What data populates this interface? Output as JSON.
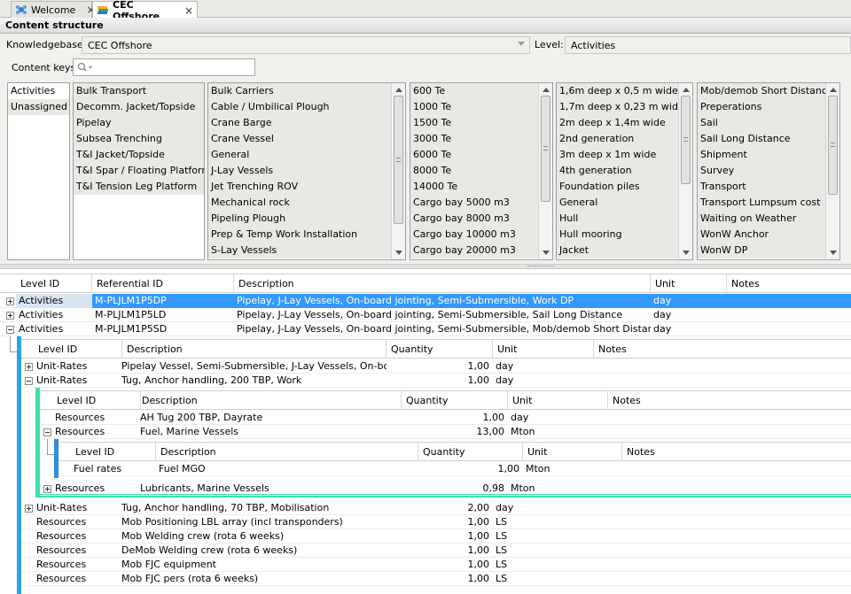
{
  "tabs": [
    {
      "label": "Welcome",
      "close": "×"
    },
    {
      "label": "CEC Offshore",
      "close": "×"
    }
  ],
  "section_title": "Content structure",
  "knowledgebase": {
    "label": "Knowledgebase:",
    "value": "CEC Offshore"
  },
  "level": {
    "label": "Level:",
    "value": "Activities"
  },
  "content_keys": {
    "label": "Content keys",
    "placeholder": ""
  },
  "lists": {
    "col1": [
      "Activities",
      "Unassigned"
    ],
    "col2": [
      "Bulk Transport",
      "Decomm. Jacket/Topside",
      "Pipelay",
      "Subsea Trenching",
      "T&I Jacket/Topside",
      "T&I Spar / Floating Platform",
      "T&I Tension Leg Platform"
    ],
    "col3": [
      "Bulk Carriers",
      "Cable / Umbilical Plough",
      "Crane Barge",
      "Crane Vessel",
      "General",
      "J-Lay Vessels",
      "Jet Trenching ROV",
      "Mechanical rock",
      "Pipeling Plough",
      "Prep & Temp Work Installation",
      "S-Lay Vessels"
    ],
    "col4": [
      "600 Te",
      "1000 Te",
      "1500 Te",
      "3000 Te",
      "6000 Te",
      "8000 Te",
      "14000 Te",
      "Cargo bay 5000 m3",
      "Cargo bay 8000 m3",
      "Cargo bay 10000 m3",
      "Cargo bay 20000 m3"
    ],
    "col5": [
      "1,6m deep x 0,5 m wide",
      "1,7m deep x 0,23 m wide",
      "2m deep x 1,4m wide",
      "2nd generation",
      "3m deep x 1m wide",
      "4th generation",
      "Foundation piles",
      "General",
      "Hull",
      "Hull mooring",
      "Jacket"
    ],
    "col6": [
      "Mob/demob Short Distance",
      "Preperations",
      "Sail",
      "Sail Long Distance",
      "Shipment",
      "Survey",
      "Transport",
      "Transport Lumpsum cost",
      "Waiting on Weather",
      "WonW Anchor",
      "WonW DP"
    ]
  },
  "main_grid": {
    "headers": [
      "Level ID",
      "Referential ID",
      "Description",
      "Unit",
      "Notes"
    ],
    "rows": [
      {
        "level": "Activities",
        "ref": "M-PLJLM1P5DP",
        "desc": "Pipelay, J-Lay Vessels, On-board jointing, Semi-Submersible, Work DP",
        "unit": "day"
      },
      {
        "level": "Activities",
        "ref": "M-PLJLM1P5LD",
        "desc": "Pipelay, J-Lay Vessels, On-board jointing, Semi-Submersible, Sail Long Distance",
        "unit": "day"
      },
      {
        "level": "Activities",
        "ref": "M-PLJLM1P5SD",
        "desc": "Pipelay, J-Lay Vessels, On-board jointing, Semi-Submersible, Mob/demob Short Distance",
        "unit": "day"
      }
    ]
  },
  "sub1": {
    "headers": [
      "Level ID",
      "Description",
      "Quantity",
      "Unit",
      "Notes"
    ],
    "rows": [
      {
        "level": "Unit-Rates",
        "desc": "Pipelay Vessel, Semi-Submersible, J-Lay Vessels, On-board ...",
        "qty": "1,00",
        "unit": "day"
      },
      {
        "level": "Unit-Rates",
        "desc": "Tug, Anchor handling, 200 TBP, Work",
        "qty": "1,00",
        "unit": "day"
      }
    ],
    "rows_after": [
      {
        "level": "Unit-Rates",
        "desc": "Tug, Anchor handling, 70 TBP, Mobilisation",
        "qty": "2,00",
        "unit": "day"
      },
      {
        "level": "Resources",
        "desc": "Mob Positioning LBL array (incl transponders)",
        "qty": "1,00",
        "unit": "LS"
      },
      {
        "level": "Resources",
        "desc": "Mob Welding crew (rota 6 weeks)",
        "qty": "1,00",
        "unit": "LS"
      },
      {
        "level": "Resources",
        "desc": "DeMob Welding crew (rota 6 weeks)",
        "qty": "1,00",
        "unit": "LS"
      },
      {
        "level": "Resources",
        "desc": "Mob FJC equipment",
        "qty": "1,00",
        "unit": "LS"
      },
      {
        "level": "Resources",
        "desc": "Mob FJC pers (rota 6 weeks)",
        "qty": "1,00",
        "unit": "LS"
      }
    ]
  },
  "sub2": {
    "headers": [
      "Level ID",
      "Description",
      "Quantity",
      "Unit",
      "Notes"
    ],
    "rows": [
      {
        "level": "Resources",
        "desc": "AH Tug 200 TBP, Dayrate",
        "qty": "1,00",
        "unit": "day"
      },
      {
        "level": "Resources",
        "desc": "Fuel, Marine Vessels",
        "qty": "13,00",
        "unit": "Mton"
      }
    ],
    "rows_after": [
      {
        "level": "Resources",
        "desc": "Lubricants, Marine Vessels",
        "qty": "0,98",
        "unit": "Mton"
      }
    ]
  },
  "sub3": {
    "headers": [
      "Level ID",
      "Description",
      "Quantity",
      "Unit",
      "Notes"
    ],
    "rows": [
      {
        "level": "Fuel rates",
        "desc": "Fuel MGO",
        "qty": "1,00",
        "unit": "Mton"
      }
    ]
  },
  "colors": {
    "selection": "#3399ff",
    "nest1": "#2aa3e6",
    "nest2": "#3ee0a8",
    "nest3": "#2b8fe0"
  }
}
